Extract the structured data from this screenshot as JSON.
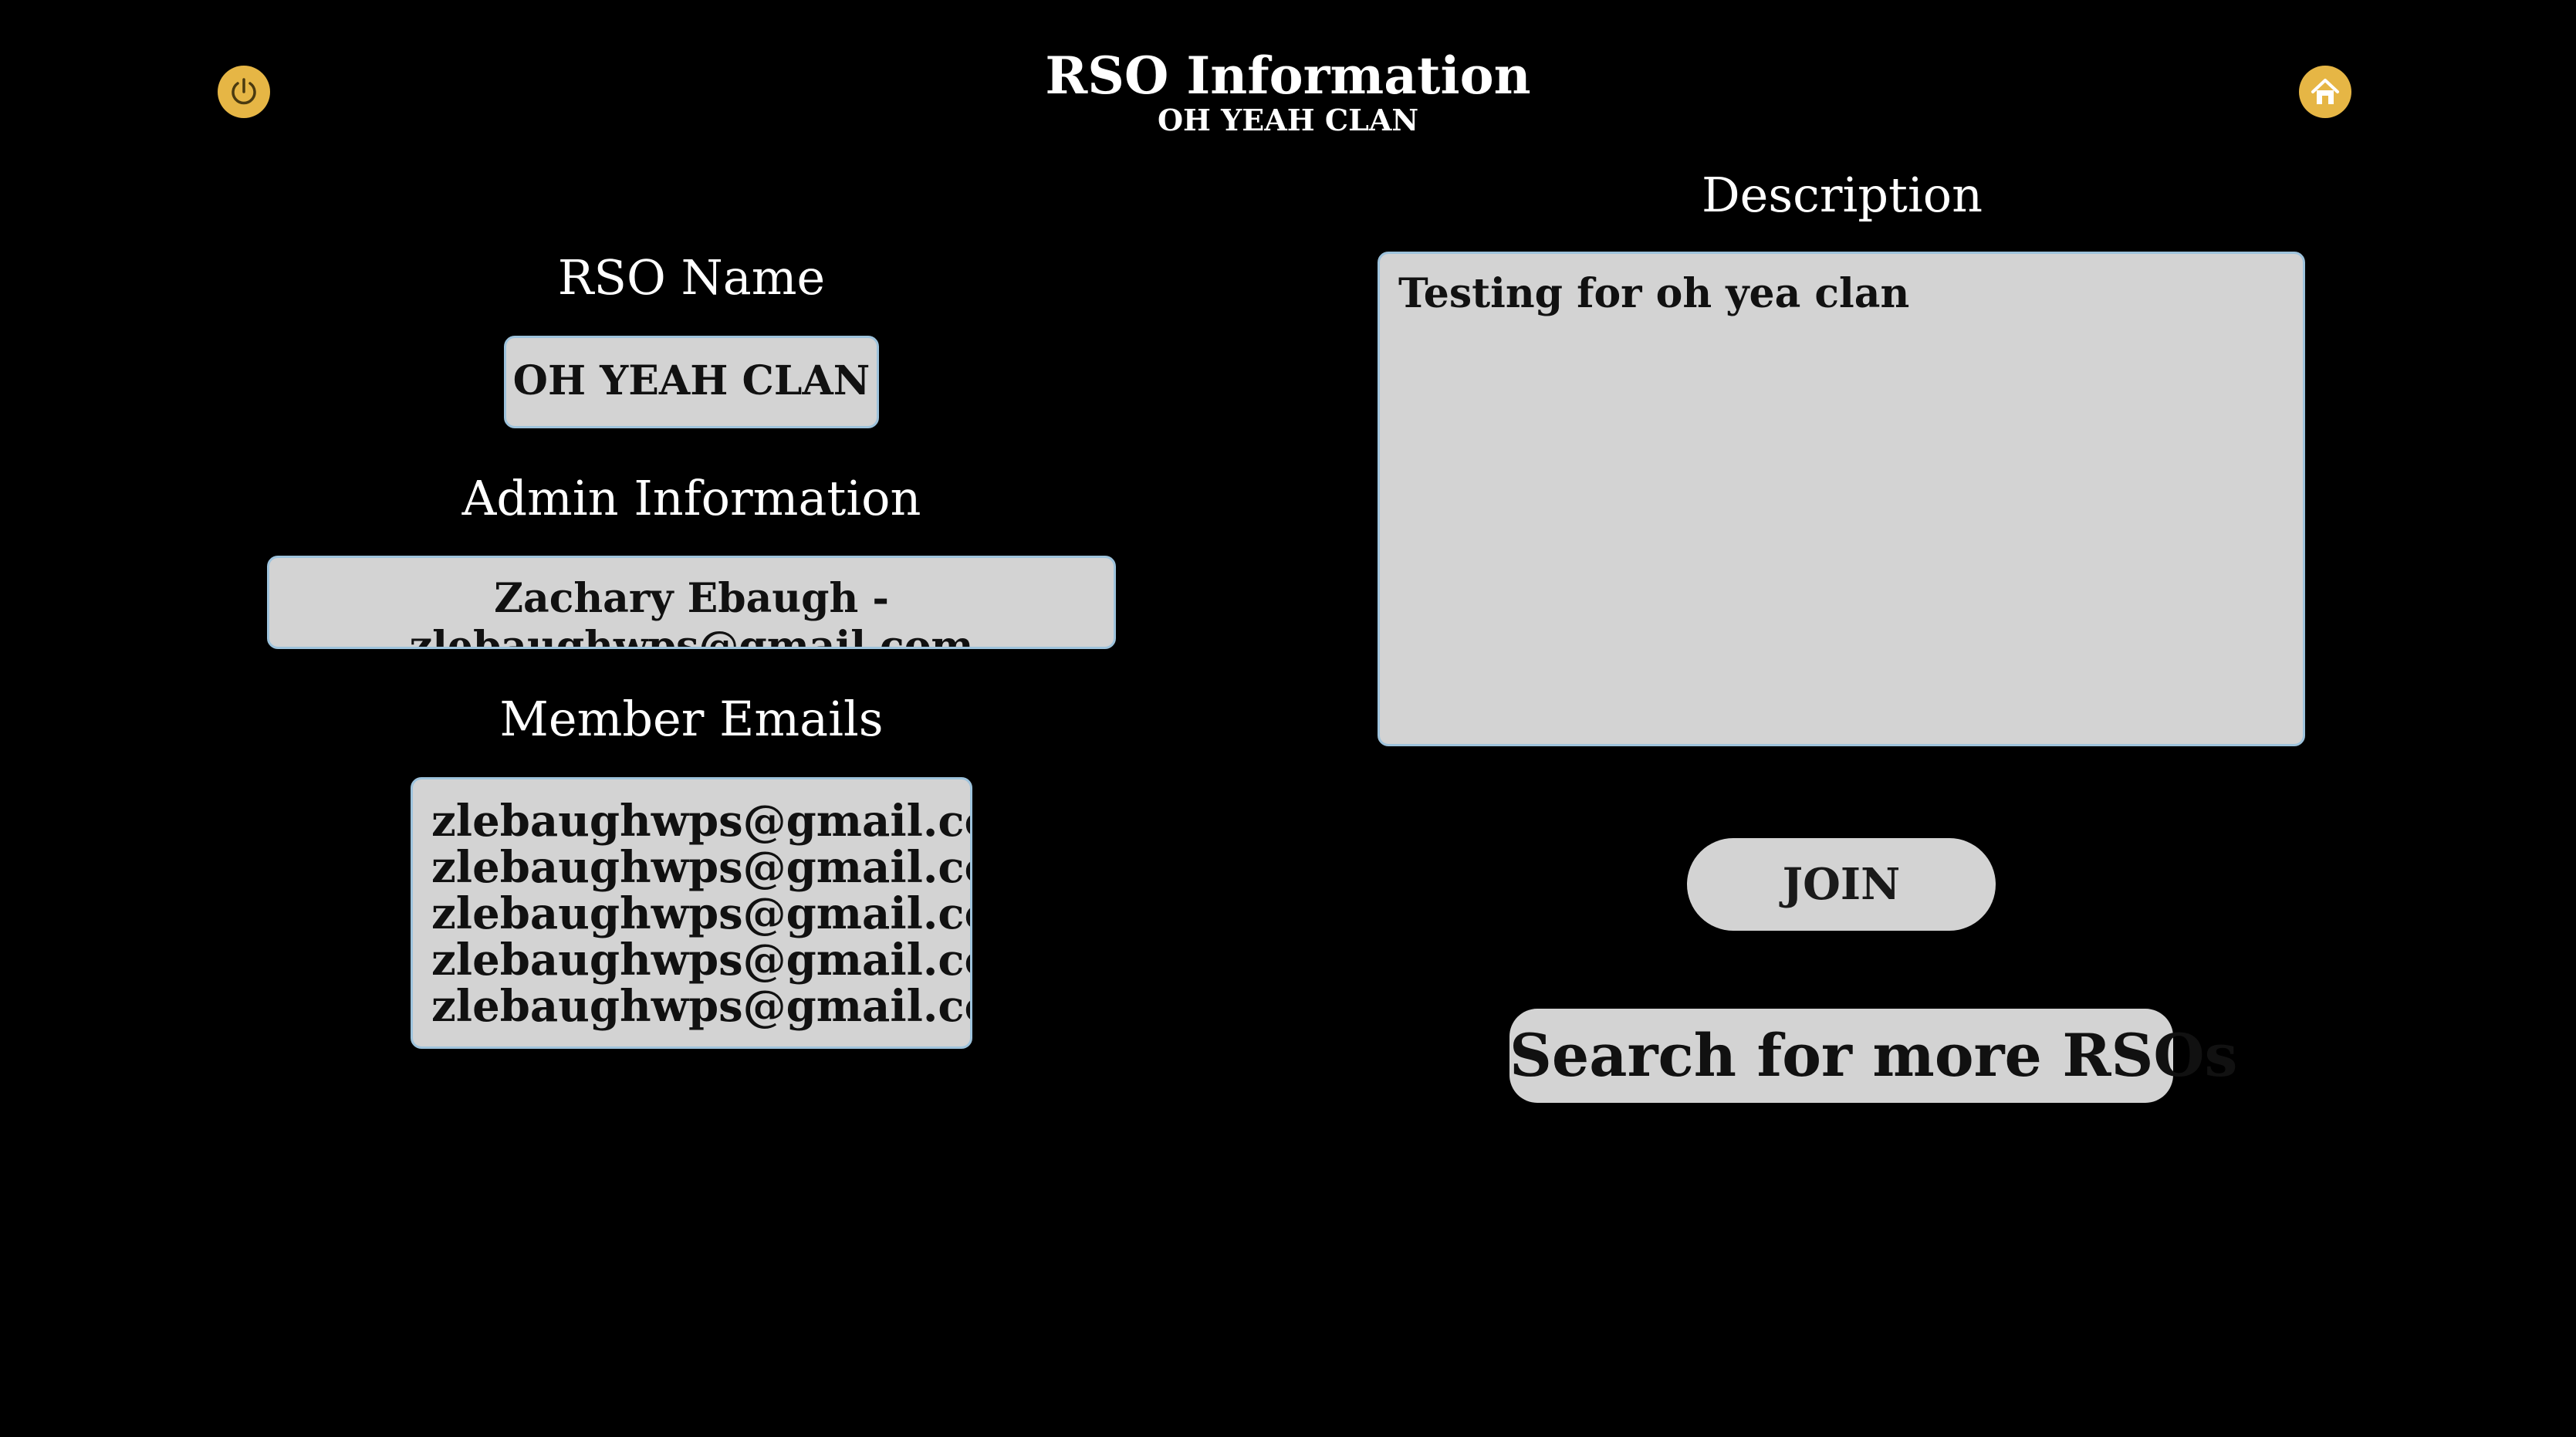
{
  "header": {
    "title": "RSO Information",
    "subtitle": "OH YEAH CLAN",
    "power_icon": "power-icon",
    "home_icon": "home-icon"
  },
  "rso_name": {
    "label": "RSO Name",
    "value": "OH YEAH CLAN"
  },
  "admin": {
    "label": "Admin Information",
    "value": "Zachary Ebaugh - zlebaughwps@gmail.com"
  },
  "members": {
    "label": "Member Emails",
    "emails": [
      "zlebaughwps@gmail.com",
      "zlebaughwps@gmail.com",
      "zlebaughwps@gmail.com",
      "zlebaughwps@gmail.com",
      "zlebaughwps@gmail.com"
    ]
  },
  "description": {
    "label": "Description",
    "value": "Testing for oh yea clan"
  },
  "actions": {
    "join_label": "JOIN",
    "search_label": "Search for more RSOs"
  },
  "colors": {
    "background": "#000000",
    "icon_accent": "#e6b645",
    "box_fill": "#d3d3d3",
    "box_border": "#9ec3dc"
  }
}
